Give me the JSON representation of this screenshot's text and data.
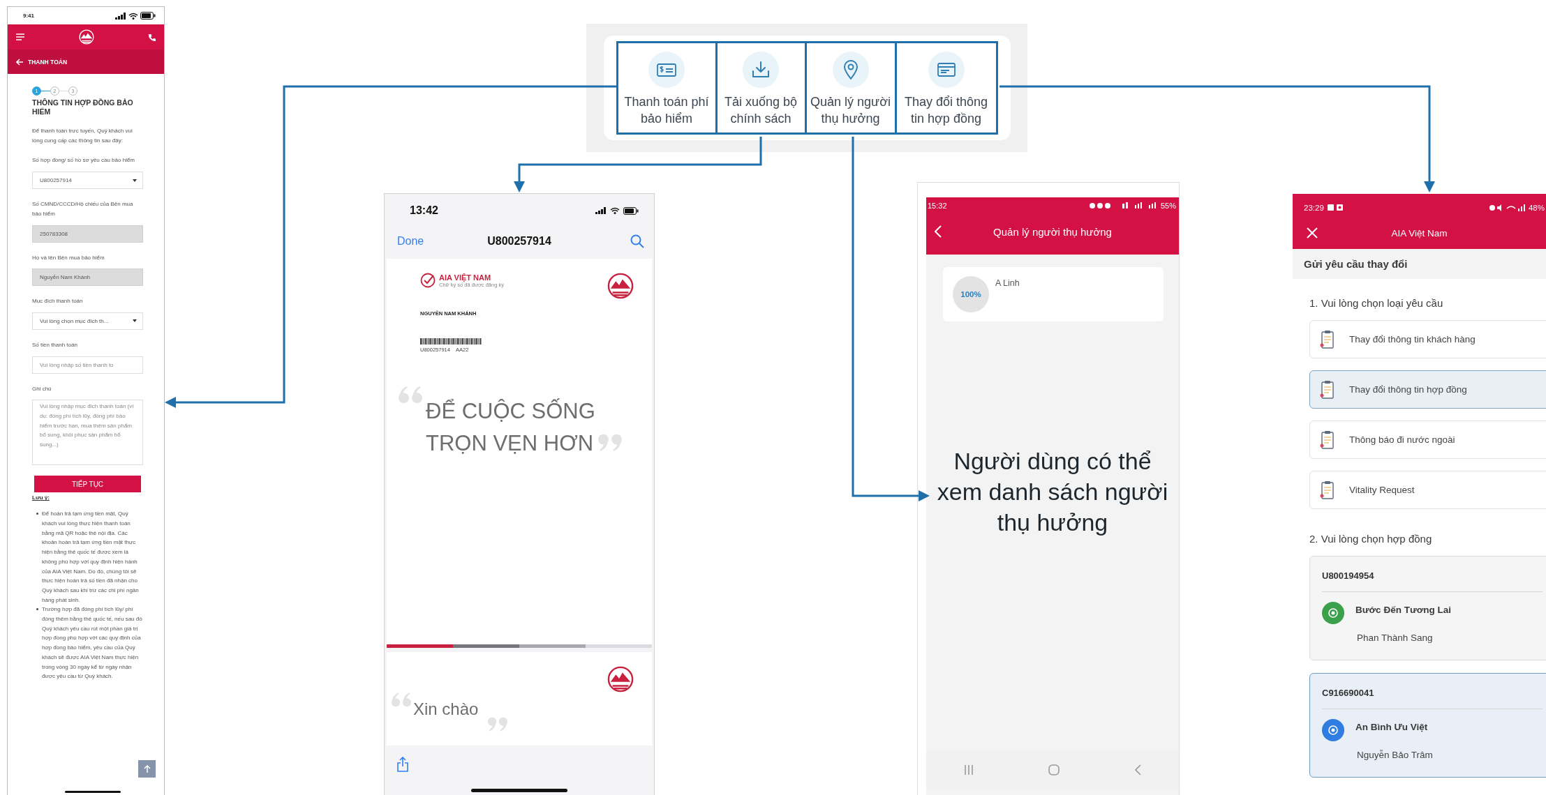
{
  "feature_menu": {
    "items": [
      {
        "kind": "payment",
        "label": "Thanh toán phí\nbảo hiểm"
      },
      {
        "kind": "download",
        "label": "Tải xuống bộ\nchính sách"
      },
      {
        "kind": "beneficiary",
        "label": "Quản lý người\nthụ hưởng"
      },
      {
        "kind": "contract",
        "label": "Thay đổi thông\ntin hợp đồng"
      }
    ]
  },
  "payment_screen": {
    "status_time": "9:41",
    "back_label": "THANH TOÁN",
    "steps": [
      {
        "label": "1",
        "selected": true
      },
      {
        "label": "2",
        "selected": false
      },
      {
        "label": "3",
        "selected": false
      }
    ],
    "title": "THÔNG TIN HỢP ĐỒNG BẢO HIỂM",
    "intro": "Để thanh toán trực tuyến, Quý khách vui lòng cung cấp các thông tin sau đây:",
    "fields": [
      {
        "kind": "select",
        "label": "Số hợp đồng/ số hồ sơ yêu cầu bảo hiểm",
        "value": "U800257914"
      },
      {
        "kind": "readonly",
        "label": "Số CMND/CCCD/Hộ chiếu của Bên mua bảo hiểm",
        "value": "250783308"
      },
      {
        "kind": "readonly",
        "label": "Họ và tên Bên mua bảo hiểm",
        "value": "Nguyễn Nam Khánh"
      },
      {
        "kind": "select",
        "label": "Mục đích thanh toán",
        "value": "Vui lòng chọn mục đích th..."
      },
      {
        "kind": "input",
        "label": "Số tiền thanh toán",
        "placeholder": "Vui lòng nhập số tiền thanh to"
      },
      {
        "kind": "textarea",
        "label": "Ghi chú",
        "placeholder": "Vui lòng nhập mục đích thanh toán (ví dụ: đóng phí tích lũy, đóng phí bảo hiểm trước hạn, mua thêm sản phẩm bổ sung, khôi phục sản phẩm bổ sung...)"
      }
    ],
    "continue_button": "TIẾP TỤC",
    "note_title": "Lưu ý:",
    "notes": [
      "Để hoàn trả tạm ứng tiền mặt, Quý khách vui lòng thực hiện thanh toán bằng mã QR hoặc thẻ nội địa. Các khoản hoàn trả tạm ứng tiền mặt thực hiện bằng thẻ quốc tế được xem là không phù hợp với quy định hiện hành của AIA Việt Nam. Do đó, chúng tôi sẽ thực hiện hoàn trả số tiền đã nhận cho Quý khách sau khi trừ các chi phí ngân hàng phát sinh.",
      "Trường hợp đã đóng phí tích lũy/ phí đóng thêm bằng thẻ quốc tế, nếu sau đó Quý khách yêu cầu rút một phần giá trị hợp đồng phù hợp với các quy định của hợp đồng bảo hiểm, yêu cầu của Quý khách sẽ được AIA Việt Nam thực hiện trong vòng 30 ngày kể từ ngày nhận được yêu cầu từ Quý khách."
    ]
  },
  "document_screen": {
    "status_time": "13:42",
    "done_label": "Done",
    "title": "U800257914",
    "brand": "AIA VIỆT NAM",
    "brand_subtitle": "Chữ ký số đã được đăng ký",
    "holder_name": "NGUYỄN NAM KHÁNH",
    "barcode_number": "U800257914",
    "barcode_suffix": "AA22",
    "headline": "ĐỂ CUỘC SỐNG\nTRỌN VẸN HƠN",
    "greeting": "Xin chào"
  },
  "beneficiary_screen": {
    "status_time": "15:32",
    "battery": "55%",
    "title": "Quản lý người thụ hưởng",
    "beneficiaries": [
      {
        "share": "100%",
        "name": "A Linh"
      }
    ],
    "annotation": "Người dùng có thể xem danh sách người thụ hưởng"
  },
  "change_request_screen": {
    "status_time": "23:29",
    "battery": "48%",
    "title": "AIA Việt Nam",
    "heading": "Gửi yêu cầu thay đổi",
    "request_prompt": "1. Vui lòng chọn loại yêu cầu",
    "request_types": [
      {
        "label": "Thay đổi thông tin khách hàng",
        "selected": false
      },
      {
        "label": "Thay đổi thông tin hợp đồng",
        "selected": true
      },
      {
        "label": "Thông báo đi nước ngoài",
        "selected": false
      },
      {
        "label": "Vitality Request",
        "selected": false
      }
    ],
    "contract_prompt": "2. Vui lòng chọn hợp đồng",
    "contracts": [
      {
        "number": "U800194954",
        "product": "Bước Đến Tương Lai",
        "owner": "Phan Thành Sang",
        "color": "#3aa04a",
        "selected": false
      },
      {
        "number": "C916690041",
        "product": "An Bình Ưu Việt",
        "owner": "Nguyễn Bảo Trâm",
        "color": "#2f7de1",
        "selected": true
      }
    ]
  }
}
